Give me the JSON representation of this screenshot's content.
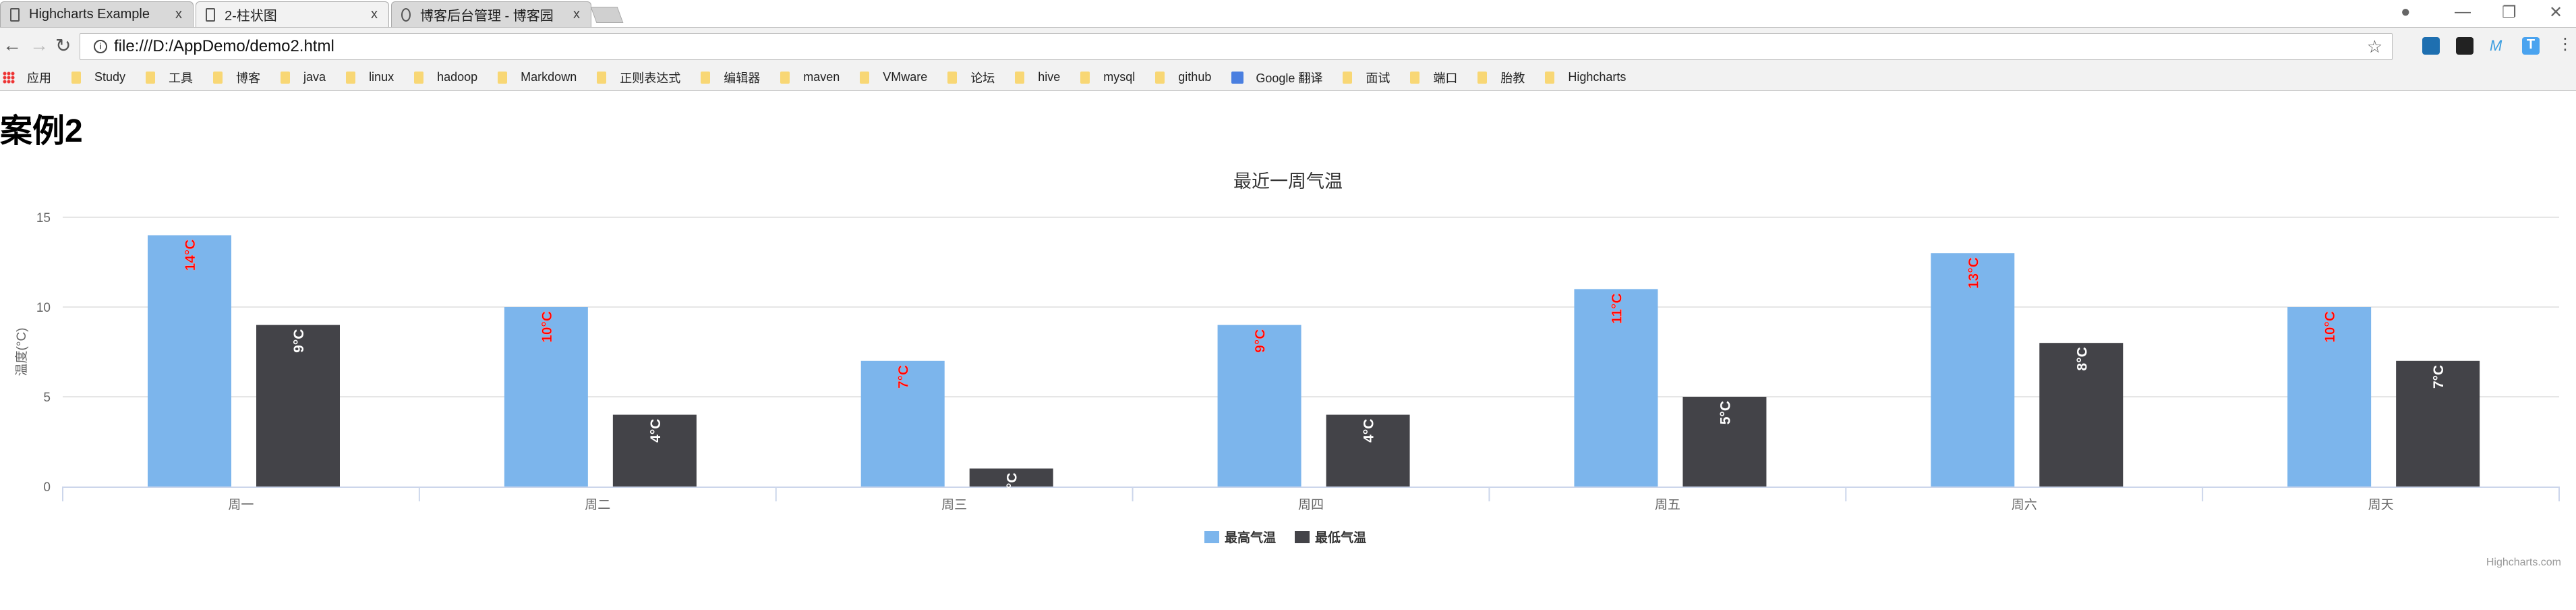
{
  "browser": {
    "tabs": [
      {
        "label": "Highcharts Example",
        "icon": "file-icon"
      },
      {
        "label": "2-柱状图",
        "icon": "file-icon",
        "active": true
      },
      {
        "label": "博客后台管理 - 博客园",
        "icon": "cnblogs-icon"
      }
    ],
    "close_glyph": "x",
    "url": "file:///D:/AppDemo/demo2.html",
    "bookmarks": [
      "应用",
      "Study",
      "工具",
      "博客",
      "java",
      "linux",
      "hadoop",
      "Markdown",
      "正则表达式",
      "编辑器",
      "maven",
      "VMware",
      "论坛",
      "hive",
      "mysql",
      "github",
      "Google 翻译",
      "面试",
      "端口",
      "胎教",
      "Highcharts"
    ]
  },
  "page": {
    "heading": "案例2"
  },
  "chart_data": {
    "type": "bar",
    "title": "最近一周气温",
    "ylabel": "温度(°C)",
    "xlabel": "",
    "ylim": [
      0,
      15
    ],
    "yticks": [
      0,
      5,
      10,
      15
    ],
    "grid": true,
    "categories": [
      "周一",
      "周二",
      "周三",
      "周四",
      "周五",
      "周六",
      "周天"
    ],
    "series": [
      {
        "name": "最高气温",
        "color": "#7cb5ec",
        "label_color": "#ff0000",
        "values": [
          14,
          10,
          7,
          9,
          11,
          13,
          10
        ]
      },
      {
        "name": "最低气温",
        "color": "#434348",
        "label_color": "#ffffff",
        "values": [
          9,
          4,
          1,
          4,
          5,
          8,
          7
        ]
      }
    ],
    "data_label_suffix": "°C",
    "legend": "bottom-center",
    "credits": "Highcharts.com"
  }
}
